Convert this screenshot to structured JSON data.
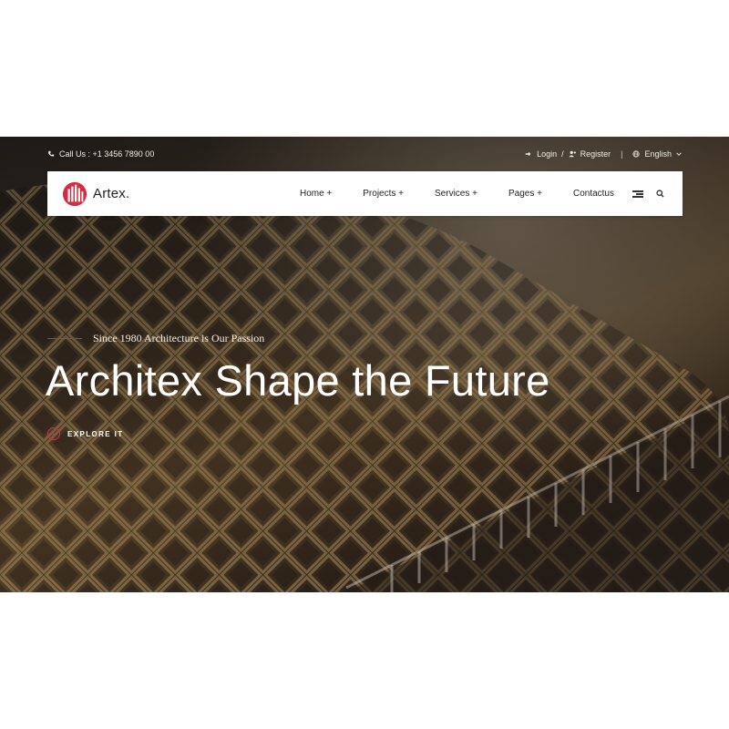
{
  "topbar": {
    "phone": "Call Us : +1 3456 7890 00",
    "login": "Login",
    "slash": "/",
    "register": "Register",
    "separator": "|",
    "language": "English"
  },
  "brand": {
    "name": "Artex."
  },
  "nav": {
    "items": [
      {
        "label": "Home +"
      },
      {
        "label": "Projects +"
      },
      {
        "label": "Services +"
      },
      {
        "label": "Pages +"
      },
      {
        "label": "Contactus"
      }
    ]
  },
  "hero": {
    "tagline": "Since 1980 Architecture is Our Passion",
    "headline": "Architex Shape the Future",
    "cta": "EXPLORE IT"
  },
  "colors": {
    "accent": "#d72b3f",
    "navbar_bg": "#ffffff"
  },
  "icons": [
    "phone-icon",
    "login-icon",
    "register-icon",
    "globe-icon",
    "chevron-down-icon",
    "menu-icon",
    "search-icon",
    "arrow-right-icon"
  ]
}
